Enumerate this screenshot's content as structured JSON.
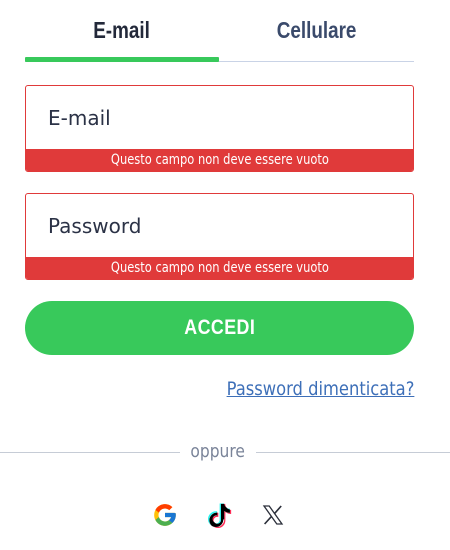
{
  "tabs": [
    {
      "label": "E-mail",
      "active": true
    },
    {
      "label": "Cellulare",
      "active": false
    }
  ],
  "email": {
    "placeholder": "E-mail",
    "value": "",
    "error": "Questo campo non deve essere vuoto"
  },
  "password": {
    "placeholder": "Password",
    "value": "",
    "error": "Questo campo non deve essere vuoto"
  },
  "submit_label": "ACCEDI",
  "forgot_label": "Password dimenticata?",
  "divider_label": "oppure",
  "social": [
    {
      "icon": "google-icon"
    },
    {
      "icon": "tiktok-icon"
    },
    {
      "icon": "x-icon"
    }
  ],
  "colors": {
    "accent": "#38c95b",
    "error": "#e03a3a",
    "link": "#3d6fb8",
    "text": "#2b3246"
  }
}
